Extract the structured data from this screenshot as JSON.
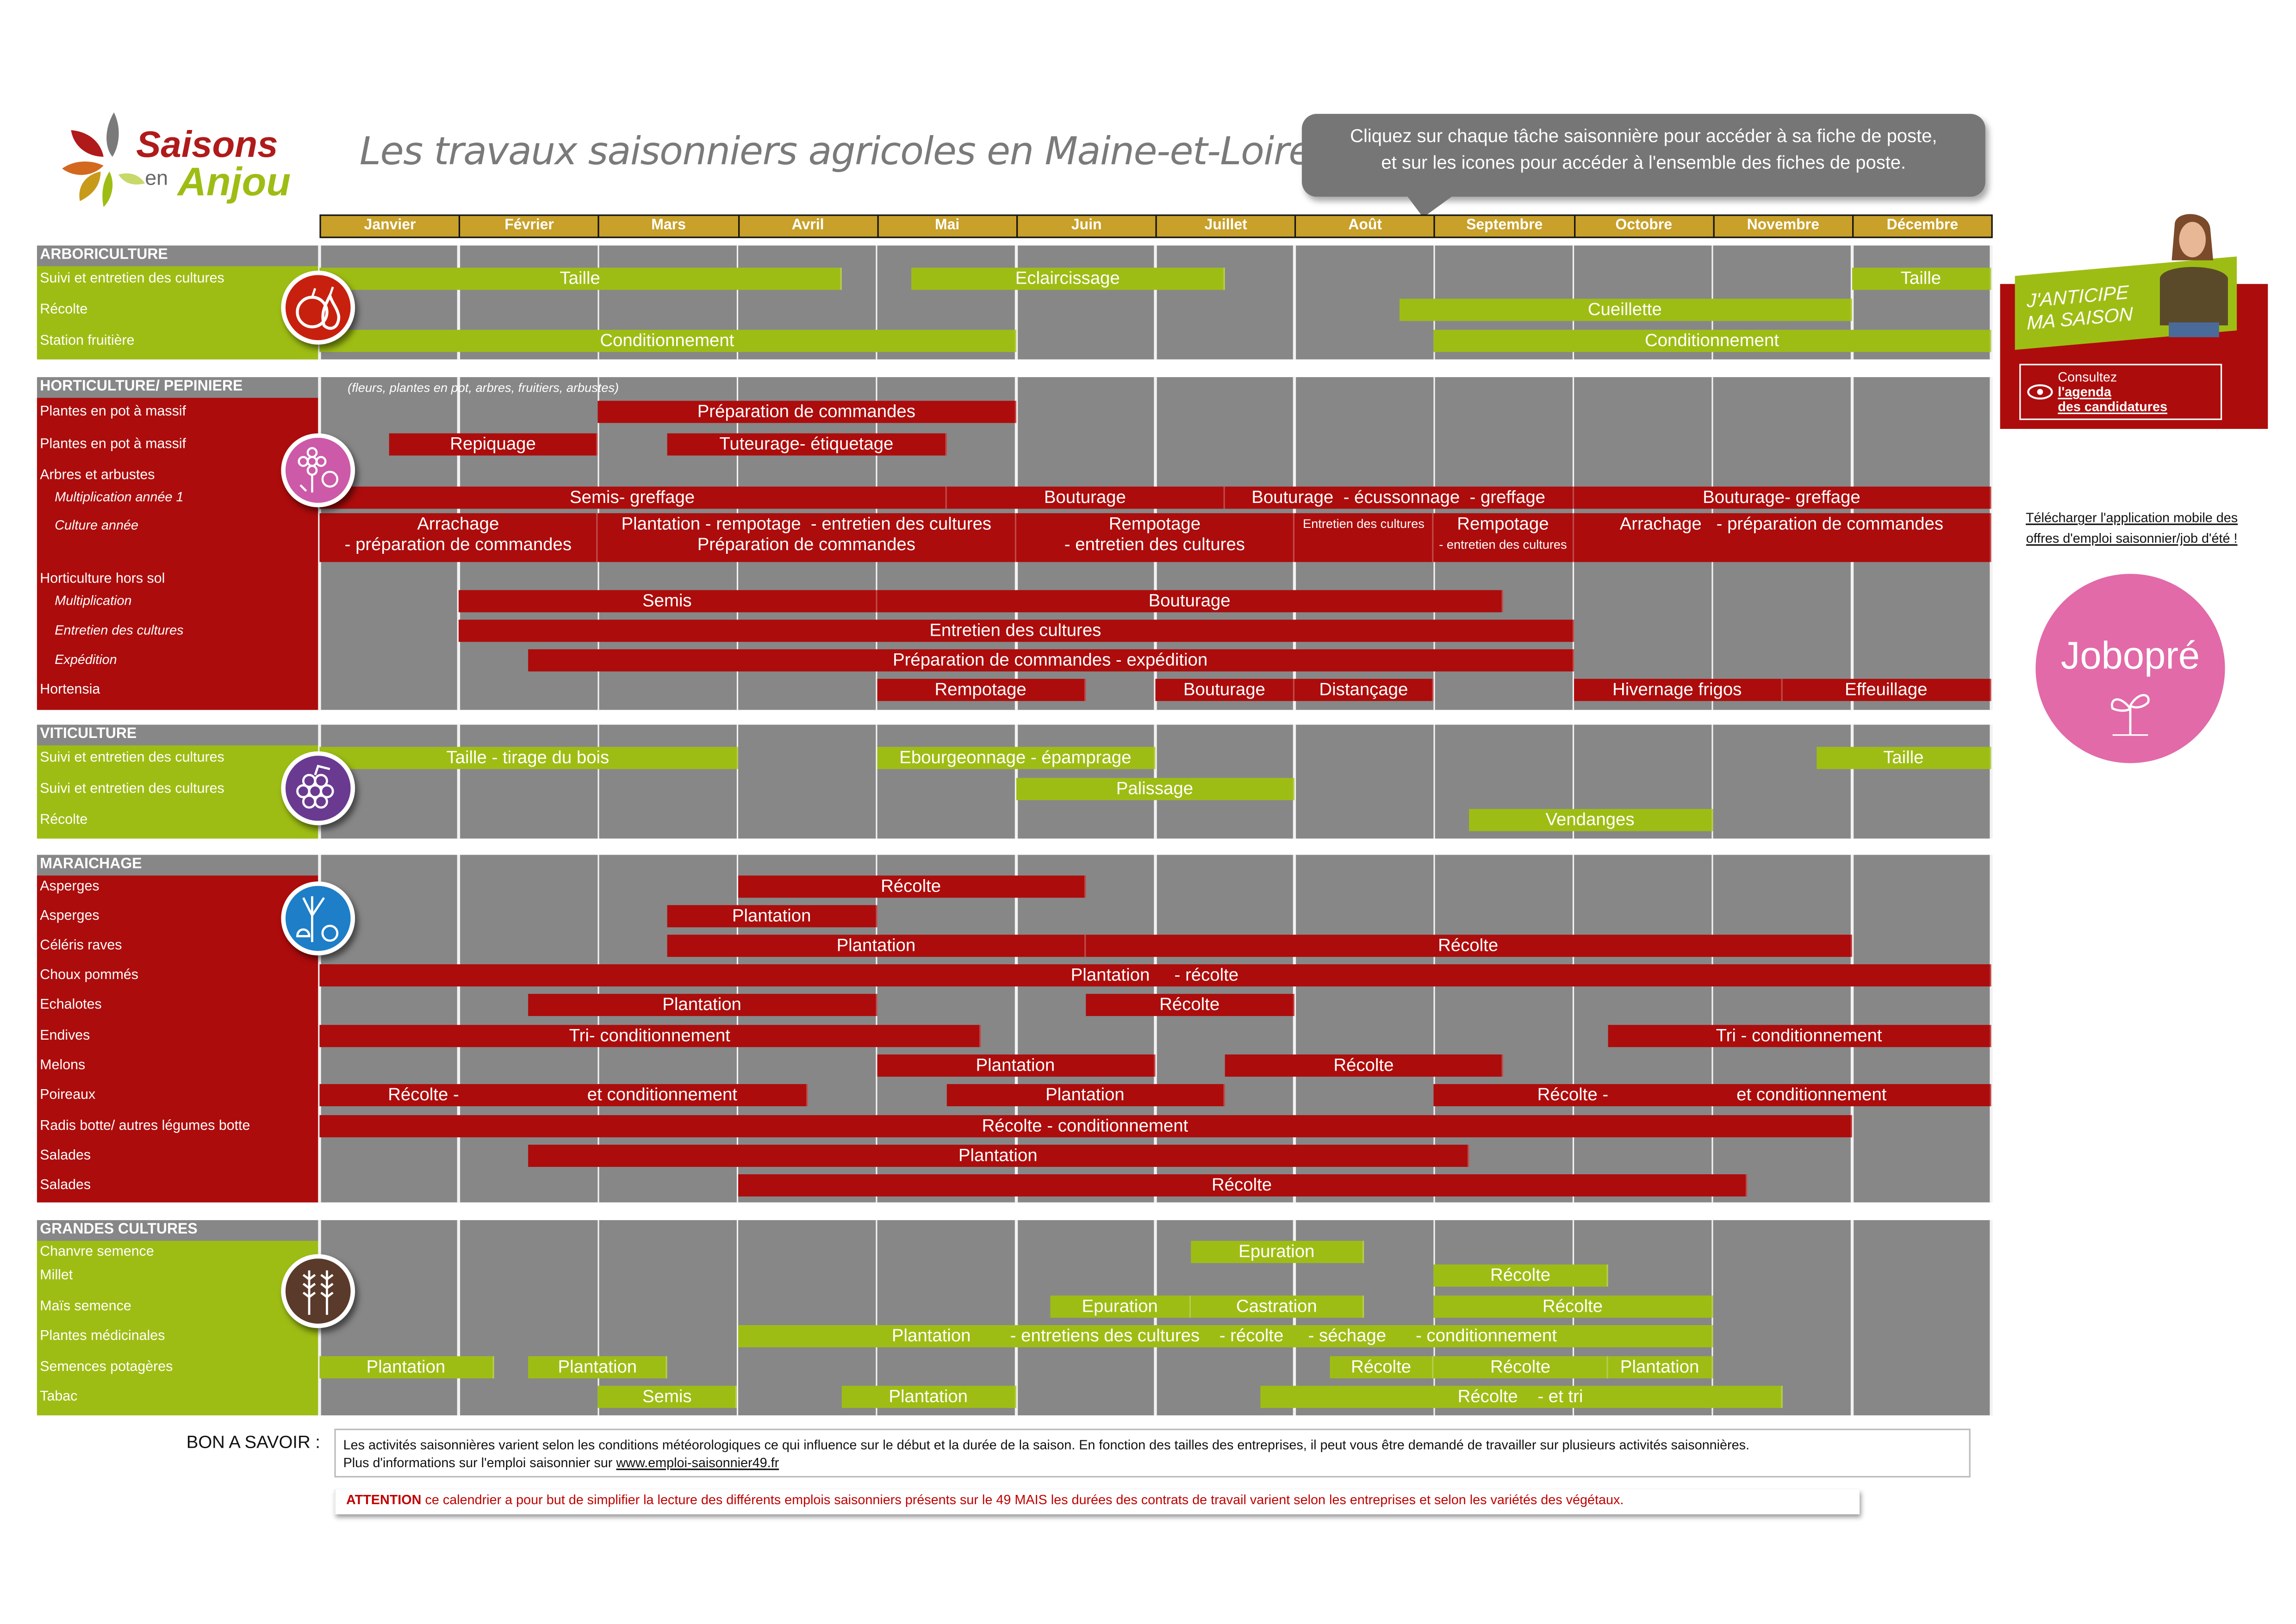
{
  "logo": {
    "line1": "Saisons",
    "line2a": "en",
    "line2b": "Anjou"
  },
  "title": "Les travaux saisonniers agricoles en Maine-et-Loire",
  "callout": {
    "line1": "Cliquez sur chaque tâche saisonnière pour accéder à sa fiche de poste,",
    "line2": "et sur les icones pour accéder à l'ensemble des fiches de poste."
  },
  "months": [
    "Janvier",
    "Février",
    "Mars",
    "Avril",
    "Mai",
    "Juin",
    "Juillet",
    "Août",
    "Septembre",
    "Octobre",
    "Novembre",
    "Décembre"
  ],
  "colors": {
    "green": "#9ebd14",
    "red": "#ad0c0c",
    "grid": "#878787",
    "month_header": "#c8a02a",
    "jobopre": "#e26aa8"
  },
  "sections": [
    {
      "id": "arboriculture",
      "title": "ARBORICULTURE",
      "color": "green",
      "icon": "apple-pear-icon",
      "rows": [
        {
          "label": "Suivi et entretien des cultures"
        },
        {
          "label": "Récolte"
        },
        {
          "label": "Station fruitière"
        }
      ],
      "bars": [
        {
          "row": 0,
          "start": 1,
          "end": 4.75,
          "label": "Taille"
        },
        {
          "row": 0,
          "start": 5.25,
          "end": 7.5,
          "label": "Eclaircissage"
        },
        {
          "row": 0,
          "start": 12,
          "end": 13,
          "label": "Taille"
        },
        {
          "row": 1,
          "start": 8.75,
          "end": 12,
          "label": "Cueillette"
        },
        {
          "row": 2,
          "start": 1,
          "end": 6,
          "label": "Conditionnement"
        },
        {
          "row": 2,
          "start": 9,
          "end": 13,
          "label": "Conditionnement"
        }
      ]
    },
    {
      "id": "horticulture",
      "title": "HORTICULTURE/ PEPINIERE",
      "note": "(fleurs, plantes en pot, arbres, fruitiers, arbustes)",
      "color": "red",
      "icon": "flower-icon",
      "rows": [
        {
          "label": "Plantes en pot à massif"
        },
        {
          "label": "Plantes en pot à massif"
        },
        {
          "label": "Arbres et arbustes"
        },
        {
          "label": "Multiplication année 1",
          "italic": true
        },
        {
          "label": "Culture année",
          "italic": true
        },
        {
          "label": "Horticulture hors sol"
        },
        {
          "label": "Multiplication",
          "italic": true
        },
        {
          "label": "Entretien des cultures",
          "italic": true
        },
        {
          "label": "Expédition",
          "italic": true
        },
        {
          "label": "Hortensia"
        }
      ],
      "bars": [
        {
          "row": 0,
          "start": 3,
          "end": 6,
          "label": "Préparation de commandes"
        },
        {
          "row": 1,
          "start": 1.5,
          "end": 3,
          "label": "Repiquage"
        },
        {
          "row": 1,
          "start": 3.5,
          "end": 5.5,
          "label": "Tuteurage- étiquetage"
        },
        {
          "row": 3,
          "start": 1,
          "end": 5.5,
          "label": "Semis- greffage"
        },
        {
          "row": 3,
          "start": 5.5,
          "end": 7.5,
          "label": "Bouturage"
        },
        {
          "row": 3,
          "start": 7.5,
          "end": 10,
          "label": "Bouturage  - écussonnage  - greffage"
        },
        {
          "row": 3,
          "start": 10,
          "end": 13,
          "label": "Bouturage- greffage"
        },
        {
          "row": 4,
          "start": 1,
          "end": 3,
          "label": "Arrachage",
          "label2": "- préparation de commandes",
          "tall": true
        },
        {
          "row": 4,
          "start": 3,
          "end": 6,
          "label": "Plantation - rempotage  - entretien des cultures",
          "label2": "Préparation de commandes",
          "tall": true
        },
        {
          "row": 4,
          "start": 6,
          "end": 8,
          "label": "Rempotage",
          "label2": "- entretien des cultures",
          "tall": true
        },
        {
          "row": 4,
          "start": 8,
          "end": 9,
          "label": "Entretien des cultures",
          "tall": true,
          "small": true
        },
        {
          "row": 4,
          "start": 9,
          "end": 10,
          "label": "Rempotage",
          "label2": "- entretien des cultures",
          "tall": true,
          "small2": true
        },
        {
          "row": 4,
          "start": 10,
          "end": 13,
          "label": "Arrachage   - préparation de commandes",
          "tall": true
        },
        {
          "row": 6,
          "start": 2,
          "end": 5,
          "label": "Semis"
        },
        {
          "row": 6,
          "start": 5,
          "end": 9.5,
          "label": "Bouturage"
        },
        {
          "row": 7,
          "start": 2,
          "end": 10,
          "label": "Entretien des cultures"
        },
        {
          "row": 8,
          "start": 2.5,
          "end": 10,
          "label": "Préparation de commandes - expédition"
        },
        {
          "row": 9,
          "start": 5,
          "end": 6.5,
          "label": "Rempotage"
        },
        {
          "row": 9,
          "start": 7,
          "end": 8,
          "label": "Bouturage"
        },
        {
          "row": 9,
          "start": 8,
          "end": 9,
          "label": "Distançage"
        },
        {
          "row": 9,
          "start": 10,
          "end": 11.5,
          "label": "Hivernage frigos"
        },
        {
          "row": 9,
          "start": 11.5,
          "end": 13,
          "label": "Effeuillage"
        }
      ]
    },
    {
      "id": "viticulture",
      "title": "VITICULTURE",
      "color": "green",
      "icon": "grapes-icon",
      "rows": [
        {
          "label": "Suivi et entretien des cultures"
        },
        {
          "label": "Suivi et entretien des cultures"
        },
        {
          "label": "Récolte"
        }
      ],
      "bars": [
        {
          "row": 0,
          "start": 1,
          "end": 4,
          "label": "Taille - tirage du bois"
        },
        {
          "row": 0,
          "start": 5,
          "end": 7,
          "label": "Ebourgeonnage - épamprage"
        },
        {
          "row": 0,
          "start": 11.75,
          "end": 13,
          "label": "Taille"
        },
        {
          "row": 1,
          "start": 6,
          "end": 8,
          "label": "Palissage"
        },
        {
          "row": 2,
          "start": 9.25,
          "end": 11,
          "label": "Vendanges"
        }
      ]
    },
    {
      "id": "maraichage",
      "title": "MARAICHAGE",
      "color": "red",
      "icon": "vegetables-icon",
      "rows": [
        {
          "label": "Asperges"
        },
        {
          "label": "Asperges"
        },
        {
          "label": "Céléris raves"
        },
        {
          "label": "Choux pommés"
        },
        {
          "label": "Echalotes"
        },
        {
          "label": "Endives"
        },
        {
          "label": "Melons"
        },
        {
          "label": "Poireaux"
        },
        {
          "label": "Radis botte/ autres légumes botte"
        },
        {
          "label": "Salades"
        },
        {
          "label": "Salades"
        }
      ],
      "bars": [
        {
          "row": 0,
          "start": 4,
          "end": 6.5,
          "label": "Récolte"
        },
        {
          "row": 1,
          "start": 3.5,
          "end": 5,
          "label": "Plantation"
        },
        {
          "row": 2,
          "start": 3.5,
          "end": 6.5,
          "label": "Plantation"
        },
        {
          "row": 2,
          "start": 6.5,
          "end": 12,
          "label": "Récolte"
        },
        {
          "row": 3,
          "start": 1,
          "end": 13,
          "label": "Plantation     - récolte"
        },
        {
          "row": 4,
          "start": 2.5,
          "end": 5,
          "label": "Plantation"
        },
        {
          "row": 4,
          "start": 6.5,
          "end": 8,
          "label": "Récolte"
        },
        {
          "row": 5,
          "start": 1,
          "end": 5.75,
          "label": "Tri- conditionnement"
        },
        {
          "row": 5,
          "start": 10.25,
          "end": 13,
          "label": "Tri - conditionnement"
        },
        {
          "row": 6,
          "start": 5,
          "end": 7,
          "label": "Plantation"
        },
        {
          "row": 6,
          "start": 7.5,
          "end": 9.5,
          "label": "Récolte"
        },
        {
          "row": 7,
          "start": 1,
          "end": 4.5,
          "label": "Récolte -                          et conditionnement"
        },
        {
          "row": 7,
          "start": 5.5,
          "end": 7.5,
          "label": "Plantation"
        },
        {
          "row": 7,
          "start": 9,
          "end": 13,
          "label": "Récolte -                          et conditionnement"
        },
        {
          "row": 8,
          "start": 1,
          "end": 12,
          "label": "Récolte - conditionnement"
        },
        {
          "row": 9,
          "start": 2.5,
          "end": 9.25,
          "label": "Plantation"
        },
        {
          "row": 10,
          "start": 4,
          "end": 11.25,
          "label": "Récolte"
        }
      ]
    },
    {
      "id": "grandes-cultures",
      "title": "GRANDES CULTURES",
      "color": "green",
      "icon": "wheat-icon",
      "rows": [
        {
          "label": "Chanvre semence"
        },
        {
          "label": "Millet"
        },
        {
          "label": "Maïs semence"
        },
        {
          "label": "Plantes médicinales"
        },
        {
          "label": "Semences potagères"
        },
        {
          "label": "Tabac"
        }
      ],
      "bars": [
        {
          "row": 0,
          "start": 7.25,
          "end": 8.5,
          "label": "Epuration"
        },
        {
          "row": 1,
          "start": 9,
          "end": 10.25,
          "label": "Récolte"
        },
        {
          "row": 2,
          "start": 6.25,
          "end": 7.25,
          "label": "Epuration"
        },
        {
          "row": 2,
          "start": 7.25,
          "end": 8.5,
          "label": "Castration"
        },
        {
          "row": 2,
          "start": 9,
          "end": 11,
          "label": "Récolte"
        },
        {
          "row": 3,
          "start": 4,
          "end": 11,
          "label": "Plantation        - entretiens des cultures    - récolte     - séchage      - conditionnement"
        },
        {
          "row": 4,
          "start": 1,
          "end": 2.25,
          "label": "Plantation"
        },
        {
          "row": 4,
          "start": 2.5,
          "end": 3.5,
          "label": "Plantation"
        },
        {
          "row": 4,
          "start": 8.25,
          "end": 9,
          "label": "Récolte"
        },
        {
          "row": 4,
          "start": 9,
          "end": 10.25,
          "label": "Récolte"
        },
        {
          "row": 4,
          "start": 10.25,
          "end": 11,
          "label": "Plantation"
        },
        {
          "row": 5,
          "start": 3,
          "end": 4,
          "label": "Semis"
        },
        {
          "row": 5,
          "start": 4.75,
          "end": 6,
          "label": "Plantation"
        },
        {
          "row": 5,
          "start": 7.75,
          "end": 11.5,
          "label": "Récolte    - et tri"
        }
      ]
    }
  ],
  "side": {
    "banner_line1": "J'ANTICIPE",
    "banner_line2": "MA SAISON",
    "consult": "Consultez",
    "agenda": "l'agenda",
    "candidatures": "des candidatures",
    "download_line1": "Télécharger l'application mobile des",
    "download_line2": "offres d'emploi saisonnier/job d'été !",
    "jobopre": "Jobopré"
  },
  "footer": {
    "bon_a_savoir": "BON A SAVOIR :",
    "info_line1": "Les activités saisonnières varient selon les conditions météorologiques ce qui influence sur le début et la durée de la saison. En fonction des tailles des entreprises, il peut vous être demandé de travailler sur plusieurs activités saisonnières.",
    "info_line2": "Plus d'informations sur l'emploi saisonnier sur ",
    "link": "www.emploi-saisonnier49.fr",
    "attention": "ATTENTION",
    "attention_text": " ce calendrier a pour but de simplifier la lecture des différents emplois saisonniers présents sur le 49 MAIS les durées des contrats de travail varient selon les entreprises et selon les variétés des végétaux."
  }
}
